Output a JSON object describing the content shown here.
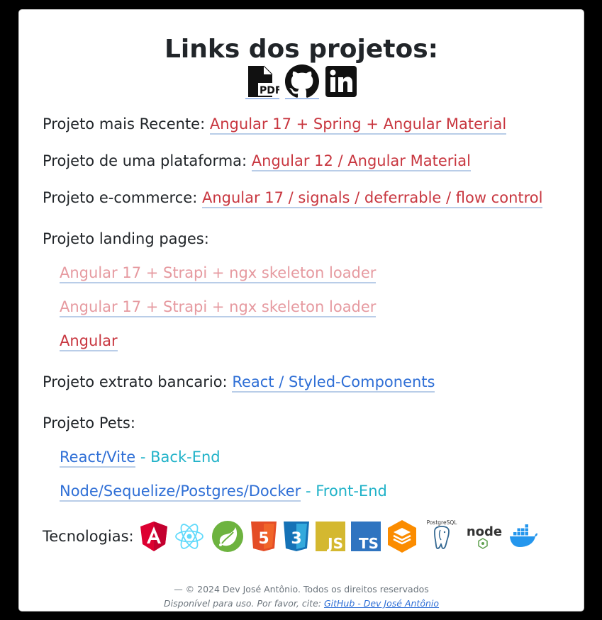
{
  "title": "Links dos projetos:",
  "top_icons": [
    "pdf-file-icon",
    "github-icon",
    "linkedin-icon"
  ],
  "rows": [
    {
      "label": "Projeto mais Recente:",
      "link": "Angular 17 + Spring + Angular Material"
    },
    {
      "label": "Projeto de uma plataforma:",
      "link": "Angular 12 / Angular Material"
    },
    {
      "label": "Projeto e-commerce:",
      "link": "Angular 17 / signals / deferrable / flow control"
    }
  ],
  "landing": {
    "label": "Projeto landing pages:",
    "items": [
      "Angular 17 + Strapi + ngx skeleton loader",
      "Angular 17 + Strapi + ngx skeleton loader",
      "Angular"
    ]
  },
  "extrato": {
    "label": "Projeto extrato bancario:",
    "link": "React / Styled-Components"
  },
  "pets": {
    "label": "Projeto Pets:",
    "items": [
      {
        "link": "React/Vite",
        "suffix": "- Back-End"
      },
      {
        "link": "Node/Sequelize/Postgres/Docker",
        "suffix": "- Front-End"
      }
    ]
  },
  "tech": {
    "label": "Tecnologias:",
    "icons": [
      "angular-icon",
      "react-icon",
      "spring-icon",
      "html5-icon",
      "css3-icon",
      "js-icon",
      "ts-icon",
      "stack-icon",
      "postgresql-icon",
      "nodejs-icon",
      "docker-icon"
    ],
    "html5_text": "5",
    "css3_text": "3",
    "js_text": "JS",
    "ts_text": "TS",
    "postgres_text": "PostgreSQL",
    "node_text": "node",
    "pdf_text": "PDF"
  },
  "footer": {
    "line1": "—  © 2024 Dev José Antônio. Todos os direitos reservados",
    "line2_prefix": "Disponível para uso. Por favor, cite:",
    "line2_link": "GitHub - Dev José Antônio"
  },
  "colors": {
    "red": "#c8363f",
    "pink": "#e69aa0",
    "blue": "#2f6fd6",
    "cyan": "#1fb2c8"
  }
}
